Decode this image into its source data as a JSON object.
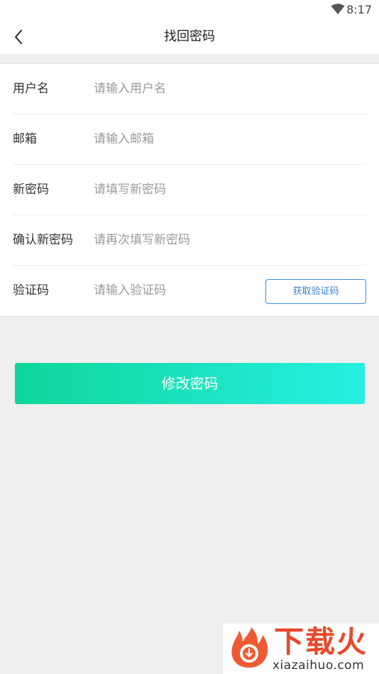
{
  "status_bar": {
    "time": "8:17",
    "icons": [
      "wifi-icon"
    ]
  },
  "header": {
    "back_icon": "chevron-left-icon",
    "title": "找回密码"
  },
  "form": {
    "fields": [
      {
        "label": "用户名",
        "placeholder": "请输入用户名",
        "value": ""
      },
      {
        "label": "邮箱",
        "placeholder": "请输入邮箱",
        "value": ""
      },
      {
        "label": "新密码",
        "placeholder": "请填写新密码",
        "value": ""
      },
      {
        "label": "确认新密码",
        "placeholder": "请再次填写新密码",
        "value": ""
      },
      {
        "label": "验证码",
        "placeholder": "请输入验证码",
        "value": ""
      }
    ],
    "get_code_label": "获取验证码"
  },
  "submit": {
    "label": "修改密码"
  },
  "watermark": {
    "name": "下载火",
    "domain": "xiazaihuo.com",
    "icon": "flame-download-logo-icon"
  },
  "colors": {
    "accent_start": "#0fd69a",
    "accent_end": "#27efe2",
    "code_button_border": "#3f8ae0",
    "background": "#efefef",
    "watermark_red": "#e8492b"
  }
}
